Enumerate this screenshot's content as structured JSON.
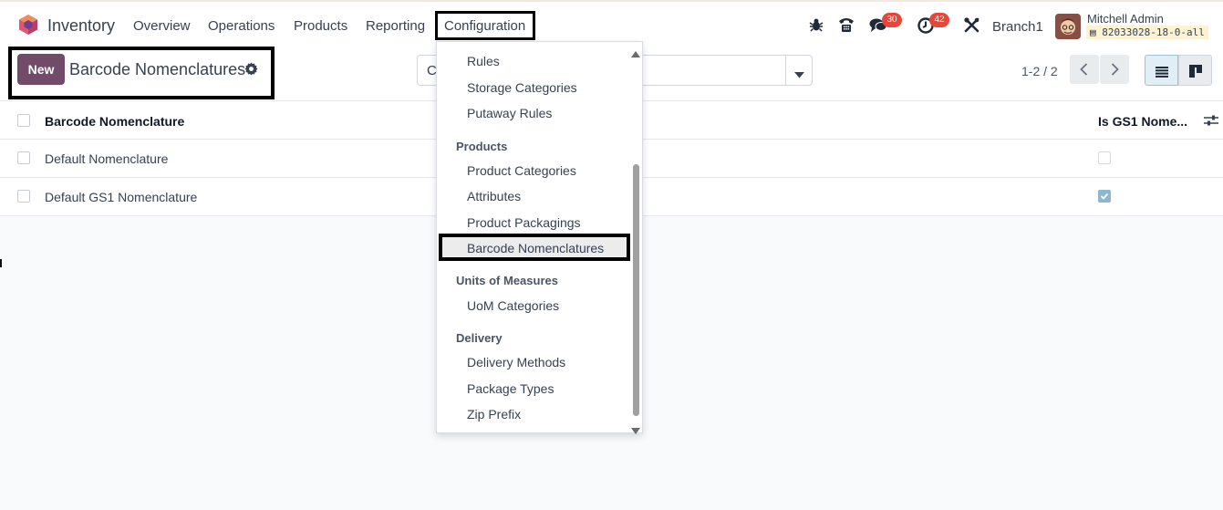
{
  "header": {
    "app_name": "Inventory",
    "nav": [
      "Overview",
      "Operations",
      "Products",
      "Reporting",
      "Configuration"
    ],
    "messages_count": "30",
    "activities_count": "42",
    "branch": "Branch1",
    "user_name": "Mitchell Admin",
    "database": "82033028-18-0-all"
  },
  "control": {
    "new_label": "New",
    "title": "Barcode Nomenclatures",
    "search_value": "C",
    "pager": "1-2 / 2"
  },
  "table": {
    "columns": [
      "Barcode Nomenclature",
      "Is GS1 Nome..."
    ],
    "rows": [
      {
        "name": "Default Nomenclature",
        "is_gs1": false
      },
      {
        "name": "Default GS1 Nomenclature",
        "is_gs1": true
      }
    ]
  },
  "menu": {
    "items_top": [
      "Rules",
      "Storage Categories",
      "Putaway Rules"
    ],
    "products_header": "Products",
    "products_items": [
      "Product Categories",
      "Attributes",
      "Product Packagings",
      "Barcode Nomenclatures"
    ],
    "uom_header": "Units of Measures",
    "uom_items": [
      "UoM Categories"
    ],
    "delivery_header": "Delivery",
    "delivery_items": [
      "Delivery Methods",
      "Package Types",
      "Zip Prefix"
    ]
  },
  "colors": {
    "primary": "#714b67",
    "badge": "#e5483a",
    "highlight": "#000000"
  }
}
